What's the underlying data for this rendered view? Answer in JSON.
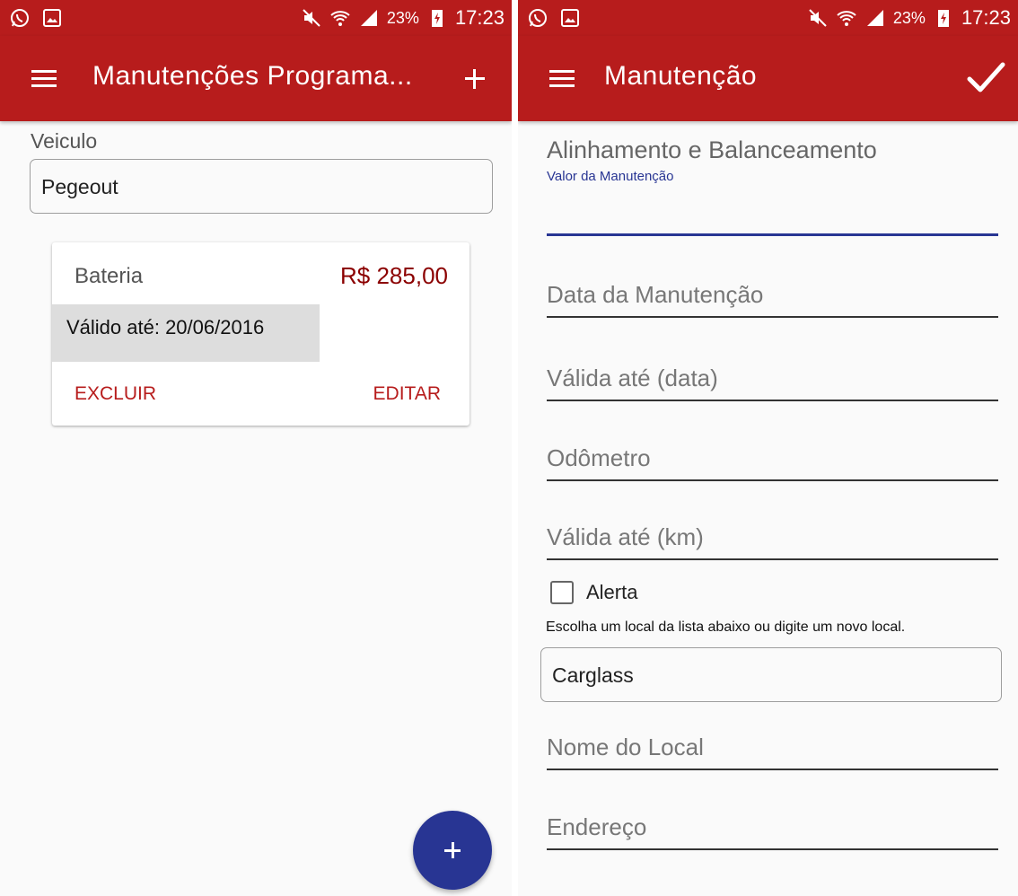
{
  "status_bar": {
    "battery_percent": "23%",
    "time": "17:23"
  },
  "left_screen": {
    "appbar": {
      "title": "Manutenções Programa..."
    },
    "vehicle": {
      "label": "Veiculo",
      "value": "Pegeout"
    },
    "card": {
      "title": "Bateria",
      "price": "R$ 285,00",
      "valid_until": "Válido até: 20/06/2016",
      "delete_label": "EXCLUIR",
      "edit_label": "EDITAR"
    }
  },
  "right_screen": {
    "appbar": {
      "title": "Manutenção"
    },
    "form": {
      "heading": "Alinhamento e Balanceamento",
      "value_label": "Valor da Manutenção",
      "value": "",
      "date_placeholder": "Data da Manutenção",
      "valid_date_placeholder": "Válida até (data)",
      "odometer_placeholder": "Odômetro",
      "valid_km_placeholder": "Válida até (km)",
      "alert_label": "Alerta",
      "alert_checked": false,
      "location_hint": "Escolha um local da lista abaixo ou digite um novo local.",
      "location_value": "Carglass",
      "location_name_placeholder": "Nome do Local",
      "address_placeholder": "Endereço"
    }
  },
  "colors": {
    "primary": "#b71c1c",
    "accent": "#283593",
    "price": "#8b0000"
  }
}
